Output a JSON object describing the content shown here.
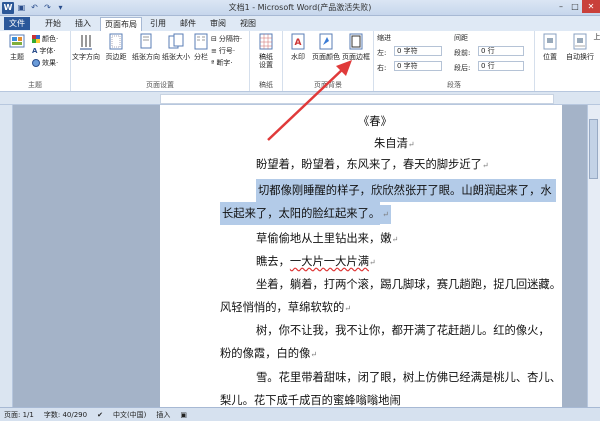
{
  "window": {
    "title": "文档1 - Microsoft Word(产品激活失败)",
    "controls": [
      "–",
      "□",
      "✕"
    ]
  },
  "quick_access": [
    "save-icon",
    "undo-icon",
    "redo-icon"
  ],
  "tabs": [
    {
      "label": "文件"
    },
    {
      "label": "开始"
    },
    {
      "label": "插入"
    },
    {
      "label": "页面布局"
    },
    {
      "label": "引用"
    },
    {
      "label": "邮件"
    },
    {
      "label": "审阅"
    },
    {
      "label": "视图"
    }
  ],
  "ribbon": {
    "themes": {
      "label": "主题",
      "big": "主题",
      "items": [
        "颜色·",
        "字体·",
        "效果·"
      ]
    },
    "page_setup": {
      "label": "页面设置",
      "buttons": [
        "文字方向",
        "页边距",
        "纸张方向",
        "纸张大小",
        "分栏"
      ],
      "small": [
        "分隔符·",
        "行号·",
        "断字·"
      ]
    },
    "draft": {
      "label": "稿纸",
      "button": "稿纸\n设置"
    },
    "page_bg": {
      "label": "页面背景",
      "buttons": [
        "水印",
        "页面颜色",
        "页面边框"
      ]
    },
    "paragraph": {
      "label": "段落",
      "indent_title": "缩进",
      "spacing_title": "间距",
      "left_label": "左:",
      "right_label": "右:",
      "left_value": "0 字符",
      "right_value": "0 字符",
      "before_label": "段前:",
      "after_label": "段后:",
      "before_value": "0 行",
      "after_value": "0 行"
    },
    "arrange": {
      "buttons": [
        "位置",
        "自动换行",
        "上"
      ]
    }
  },
  "document": {
    "lines": [
      {
        "text": "《春》",
        "mark": ""
      },
      {
        "text": "朱自清",
        "mark": "↵"
      },
      {
        "text": "盼望着，盼望着，东风来了，春天的脚步近了",
        "mark": "↵"
      },
      {
        "text": "切都像刚睡醒的样子，欣欣然张开了眼。山朗润起来了，水",
        "mark": ""
      },
      {
        "text": "长起来了，太阳的脸红起来了。",
        "mark": "↵"
      },
      {
        "text": "草偷偷地从土里钻出来，嫩",
        "mark": "↵"
      },
      {
        "text_a": "瞧去，",
        "text_b": "一大片一大片满",
        "mark": "↵"
      },
      {
        "text": "坐着，躺着，打两个滚，踢几脚球，赛几趟跑，捉几回迷藏。",
        "mark": ""
      },
      {
        "text": "风轻悄悄的，草绵软软的",
        "mark": "↵"
      },
      {
        "text": "树，你不让我，我不让你，都开满了花赶趟儿。红的像火，",
        "mark": ""
      },
      {
        "text": "粉的像霞，白的像",
        "mark": "↵"
      },
      {
        "text": "雪。花里带着甜味，闭了眼，树上仿佛已经满是桃儿、杏儿、",
        "mark": ""
      },
      {
        "text": "梨儿。花下成千成百的蜜蜂嗡嗡地闹",
        "mark": ""
      }
    ]
  },
  "status": {
    "page": "页面: 1/1",
    "words": "字数: 40/290",
    "lang": "中文(中国)",
    "mode": "插入"
  },
  "colors": {
    "accent": "#2a579a",
    "highlight": "#b3cbe8",
    "arrow": "#e03a3a"
  }
}
